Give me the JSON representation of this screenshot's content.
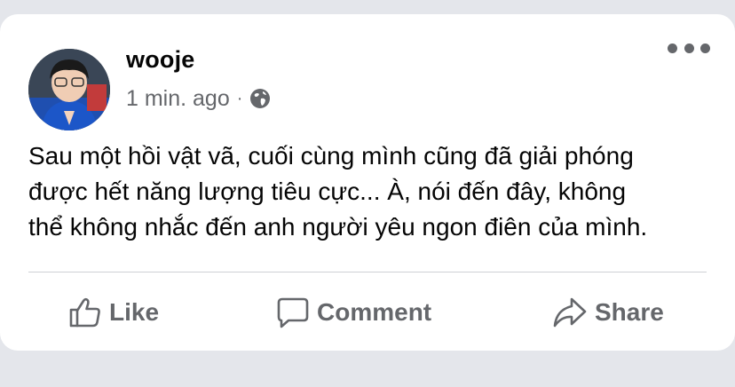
{
  "post": {
    "author": "wooje",
    "timestamp": "1 min. ago",
    "separator": "·",
    "privacy_icon": "globe-icon",
    "text_lines": [
      "Sau một hồi vật vã, cuối cùng mình cũng đã giải phóng",
      "được hết năng lượng tiêu cực... À, nói đến đây, không",
      "thể không nhắc đến anh người yêu ngon điên của mình."
    ]
  },
  "actions": {
    "like": {
      "label": "Like",
      "icon": "thumbs-up-icon"
    },
    "comment": {
      "label": "Comment",
      "icon": "comment-bubble-icon"
    },
    "share": {
      "label": "Share",
      "icon": "share-arrow-icon"
    }
  },
  "colors": {
    "background": "#e4e6eb",
    "card": "#ffffff",
    "primary_text": "#050505",
    "secondary_text": "#65676b",
    "divider": "#ced0d4"
  }
}
